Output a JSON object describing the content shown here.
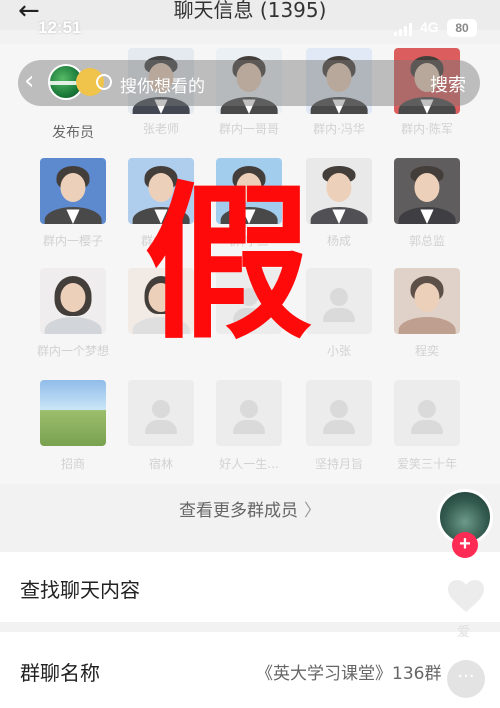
{
  "header": {
    "title": "聊天信息 (1395)"
  },
  "status_bar": {
    "time": "12:51",
    "network": "4G",
    "battery": "80"
  },
  "search": {
    "placeholder": "搜你想看的",
    "button": "搜索",
    "publisher_label": "发布员"
  },
  "members": {
    "row1": [
      "张老师",
      "群内一哥哥",
      "群内·冯华",
      "群内·陈军"
    ],
    "row2": [
      "群内一樱子",
      "群内·二",
      "群内·三",
      "杨成",
      "郭总监"
    ],
    "row3": [
      "群内一个梦想",
      "",
      "",
      "小张",
      "程奕"
    ],
    "row4": [
      "招商",
      "宿林",
      "好人一生...",
      "坚持月旨",
      "爱笑三十年"
    ]
  },
  "watermark": "假",
  "view_more": {
    "label": "查看更多群成员",
    "chevron": "〉"
  },
  "find_chat": {
    "label": "查找聊天内容"
  },
  "group_name": {
    "label": "群聊名称",
    "value": "《英大学习课堂》136群"
  },
  "like": {
    "label": "爱"
  },
  "float": {
    "plus": "+"
  }
}
